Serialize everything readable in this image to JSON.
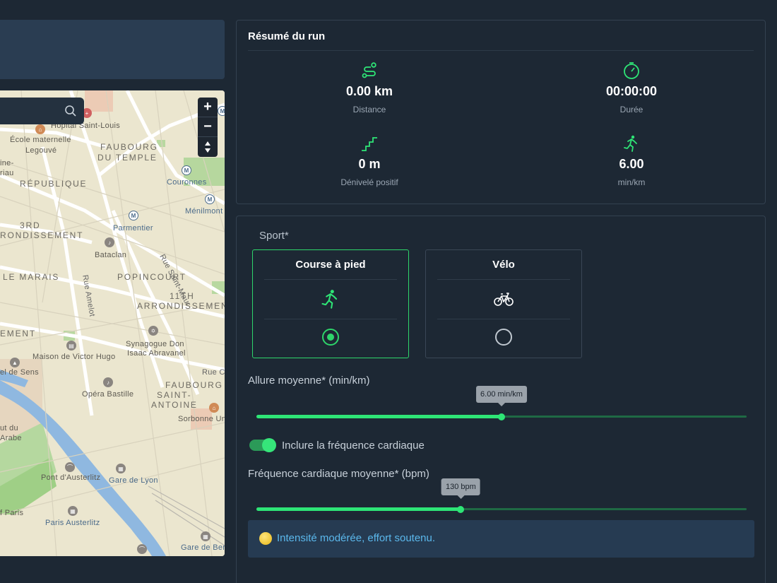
{
  "map": {
    "search_placeholder": "",
    "zoom_in": "+",
    "zoom_out": "−",
    "compass": "▲▼",
    "labels": {
      "hopital": "Hôpital Saint-Louis",
      "ecole1": "École maternelle",
      "ecole2": "Legouvé",
      "faubourg_temple1": "FAUBOURG",
      "faubourg_temple2": "DU TEMPLE",
      "republique": "RÉPUBLIQUE",
      "ine": "ine-",
      "riau": "riau",
      "couronnes": "Couronnes",
      "menilmont": "Ménilmont",
      "third1": "3RD",
      "third2": "RONDISSEMENT",
      "parmentier": "Parmentier",
      "rue_saint_maur": "Rue Saint-Maur",
      "bataclan": "Bataclan",
      "le_marais": "LE MARAIS",
      "popincourt": "POPINCOURT",
      "rue_amelot": "Rue Amelot",
      "eleventh1": "11TH",
      "eleventh2": "ARRONDISSEMENT",
      "ement": "EMENT",
      "synagogue1": "Synagogue Don",
      "synagogue2": "Isaac Abravanel",
      "victor_hugo": "Maison de Victor Hugo",
      "el_de_sens": "el de Sens",
      "rue_c": "Rue C",
      "faubourg_antoine1": "FAUBOURG",
      "faubourg_antoine2": "SAINT-",
      "faubourg_antoine3": "ANTOINE",
      "opera": "Opéra Bastille",
      "sorbonne": "Sorbonne Un",
      "ut_du": "ut du",
      "arabe": "Arabe",
      "pont": "Pont d'Austerlitz",
      "gare_lyon": "Gare de Lyon",
      "f_paris": "f Paris",
      "paris_austerlitz": "Paris Austerlitz",
      "gare_de_ber": "Gare de Ber"
    }
  },
  "summary": {
    "title": "Résumé du run",
    "stats": [
      {
        "value": "0.00 km",
        "label": "Distance",
        "icon": "route-icon"
      },
      {
        "value": "00:00:00",
        "label": "Durée",
        "icon": "timer-icon"
      },
      {
        "value": "0 m",
        "label": "Dénivelé positif",
        "icon": "stairs-icon"
      },
      {
        "value": "6.00",
        "label": "min/km",
        "icon": "runner-icon"
      }
    ]
  },
  "form": {
    "sport_label": "Sport*",
    "sports": [
      {
        "name": "Course à pied",
        "icon": "runner-icon",
        "selected": true
      },
      {
        "name": "Vélo",
        "icon": "bicycle-icon",
        "selected": false
      }
    ],
    "pace_label": "Allure moyenne* (min/km)",
    "pace_tooltip": "6.00 min/km",
    "pace_fraction": 0.5,
    "heart_toggle_label": "Inclure la fréquence cardiaque",
    "heart_toggle_on": true,
    "heart_label": "Fréquence cardiaque moyenne* (bpm)",
    "heart_tooltip": "130 bpm",
    "heart_fraction": 0.417,
    "info_text": "Intensité modérée, effort soutenu.",
    "accent_color": "#2ee576"
  }
}
